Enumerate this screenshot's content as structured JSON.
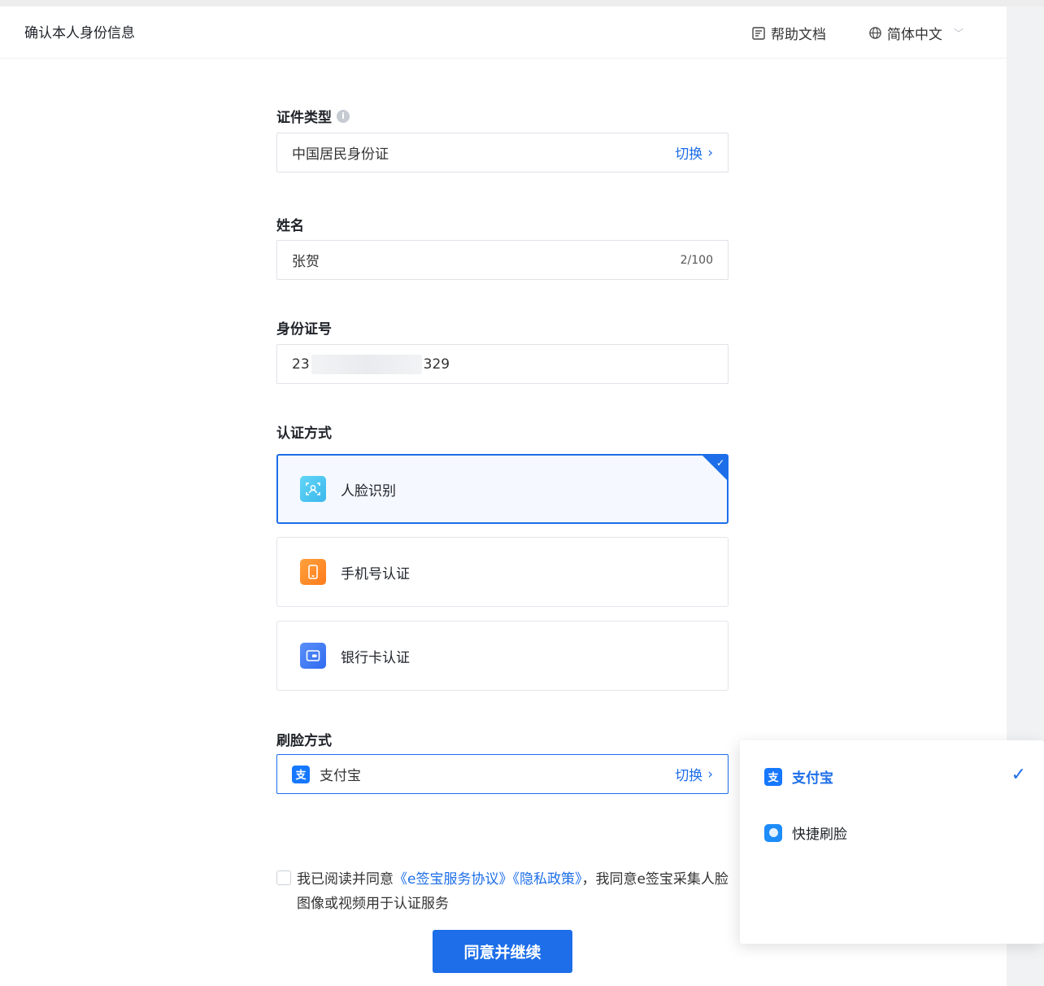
{
  "header": {
    "title": "确认本人身份信息",
    "help_label": "帮助文档",
    "language_label": "简体中文"
  },
  "form": {
    "id_type": {
      "label": "证件类型",
      "value": "中国居民身份证",
      "switch_label": "切换"
    },
    "name": {
      "label": "姓名",
      "value": "张贺",
      "counter": "2/100"
    },
    "id_number": {
      "label": "身份证号",
      "value_prefix": "23",
      "value_suffix": "329"
    },
    "auth_method": {
      "label": "认证方式",
      "options": [
        {
          "label": "人脸识别",
          "icon": "face-scan-icon",
          "selected": true
        },
        {
          "label": "手机号认证",
          "icon": "phone-icon",
          "selected": false
        },
        {
          "label": "银行卡认证",
          "icon": "bank-card-icon",
          "selected": false
        }
      ]
    },
    "face_method": {
      "label": "刷脸方式",
      "value": "支付宝",
      "switch_label": "切换"
    }
  },
  "dropdown": {
    "options": [
      {
        "label": "支付宝",
        "icon": "alipay-icon",
        "selected": true
      },
      {
        "label": "快捷刷脸",
        "icon": "quick-face-icon",
        "selected": false
      }
    ]
  },
  "agreement": {
    "prefix": "我已阅读并同意",
    "link_service": "《e签宝服务协议》",
    "link_privacy": "《隐私政策》",
    "suffix": "，我同意e签宝采集人脸图像或视频用于认证服务"
  },
  "submit_label": "同意并继续",
  "colors": {
    "primary": "#1d6ee8",
    "border": "#dfe2e7",
    "text": "#1f2329"
  }
}
